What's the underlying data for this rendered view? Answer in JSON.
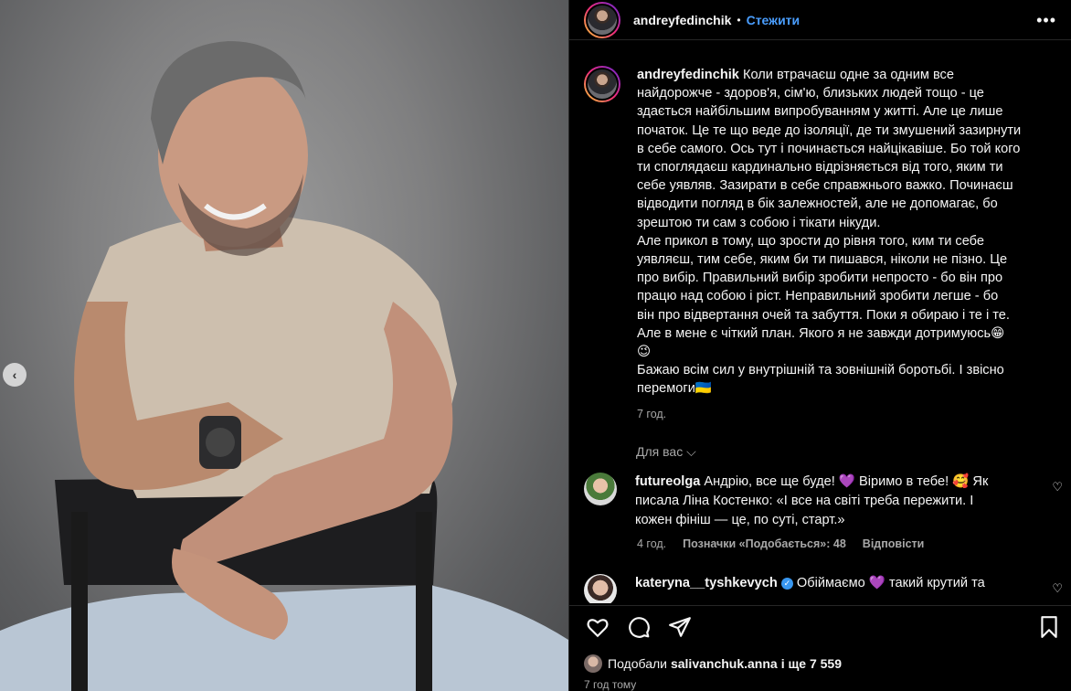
{
  "post": {
    "username": "andreyfedinchik",
    "follow_label": "Стежити",
    "caption_lines": [
      "Коли втрачаєш одне за одним все",
      "найдорожче - здоров'я, сім'ю, близьких людей тощо - це",
      "здається найбільшим випробуванням у житті. Але це лише",
      "початок. Це те що веде до ізоляції, де ти змушений зазирнути",
      "в себе самого. Ось тут і починається найцікавіше. Бо той кого",
      "ти споглядаєш кардинально відрізняється від того, яким ти",
      "себе уявляв. Зазирати в себе справжнього важко. Починаєш",
      "відводити погляд в бік залежностей, але не допомагає, бо",
      "зрештою ти сам з собою і тікати нікуди.",
      "Але прикол в тому, що зрости до рівня того, ким ти себе",
      "уявляєш, тим себе, яким би ти пишався, ніколи не пізно. Це",
      "про вибір. Правильний вибір зробити непросто - бо він про",
      "працю над собою і ріст. Неправильний зробити легше - бо",
      "він про відвертання очей та забуття. Поки я обираю і те і те.",
      "Але в мене є чіткий план. Якого я не завжди дотримуюсь😁",
      "😉",
      "Бажаю всім сил у внутрішній та зовнішній боротьбі. І звісно",
      "перемоги🇺🇦"
    ],
    "caption_time": "7 год.",
    "likes_prefix": "Подобали",
    "likes_user": "salivanchuk.anna",
    "likes_suffix": "і ще 7 559",
    "post_time": "7 год тому"
  },
  "for_you_label": "Для вас",
  "comments": [
    {
      "username": "futureolga",
      "lines": [
        "Андрію, все ще буде! 💜 Віримо в тебе! 🥰 Як",
        "писала Ліна Костенко: «І все на світі треба пережити. І",
        "кожен фініш — це, по суті, старт.»"
      ],
      "time": "4 год.",
      "likes": "Позначки «Подобається»: 48",
      "reply": "Відповісти"
    },
    {
      "username": "kateryna__tyshkevych",
      "lines": [
        "Обіймаємо 💜 такий крутий та"
      ]
    }
  ],
  "colors": {
    "link": "#4a9eff",
    "muted": "#a8a8a8",
    "bg": "#000000"
  },
  "icons": [
    "more-icon",
    "heart-icon",
    "comment-icon",
    "share-icon",
    "bookmark-icon",
    "chevron-left-icon",
    "verified-icon"
  ]
}
